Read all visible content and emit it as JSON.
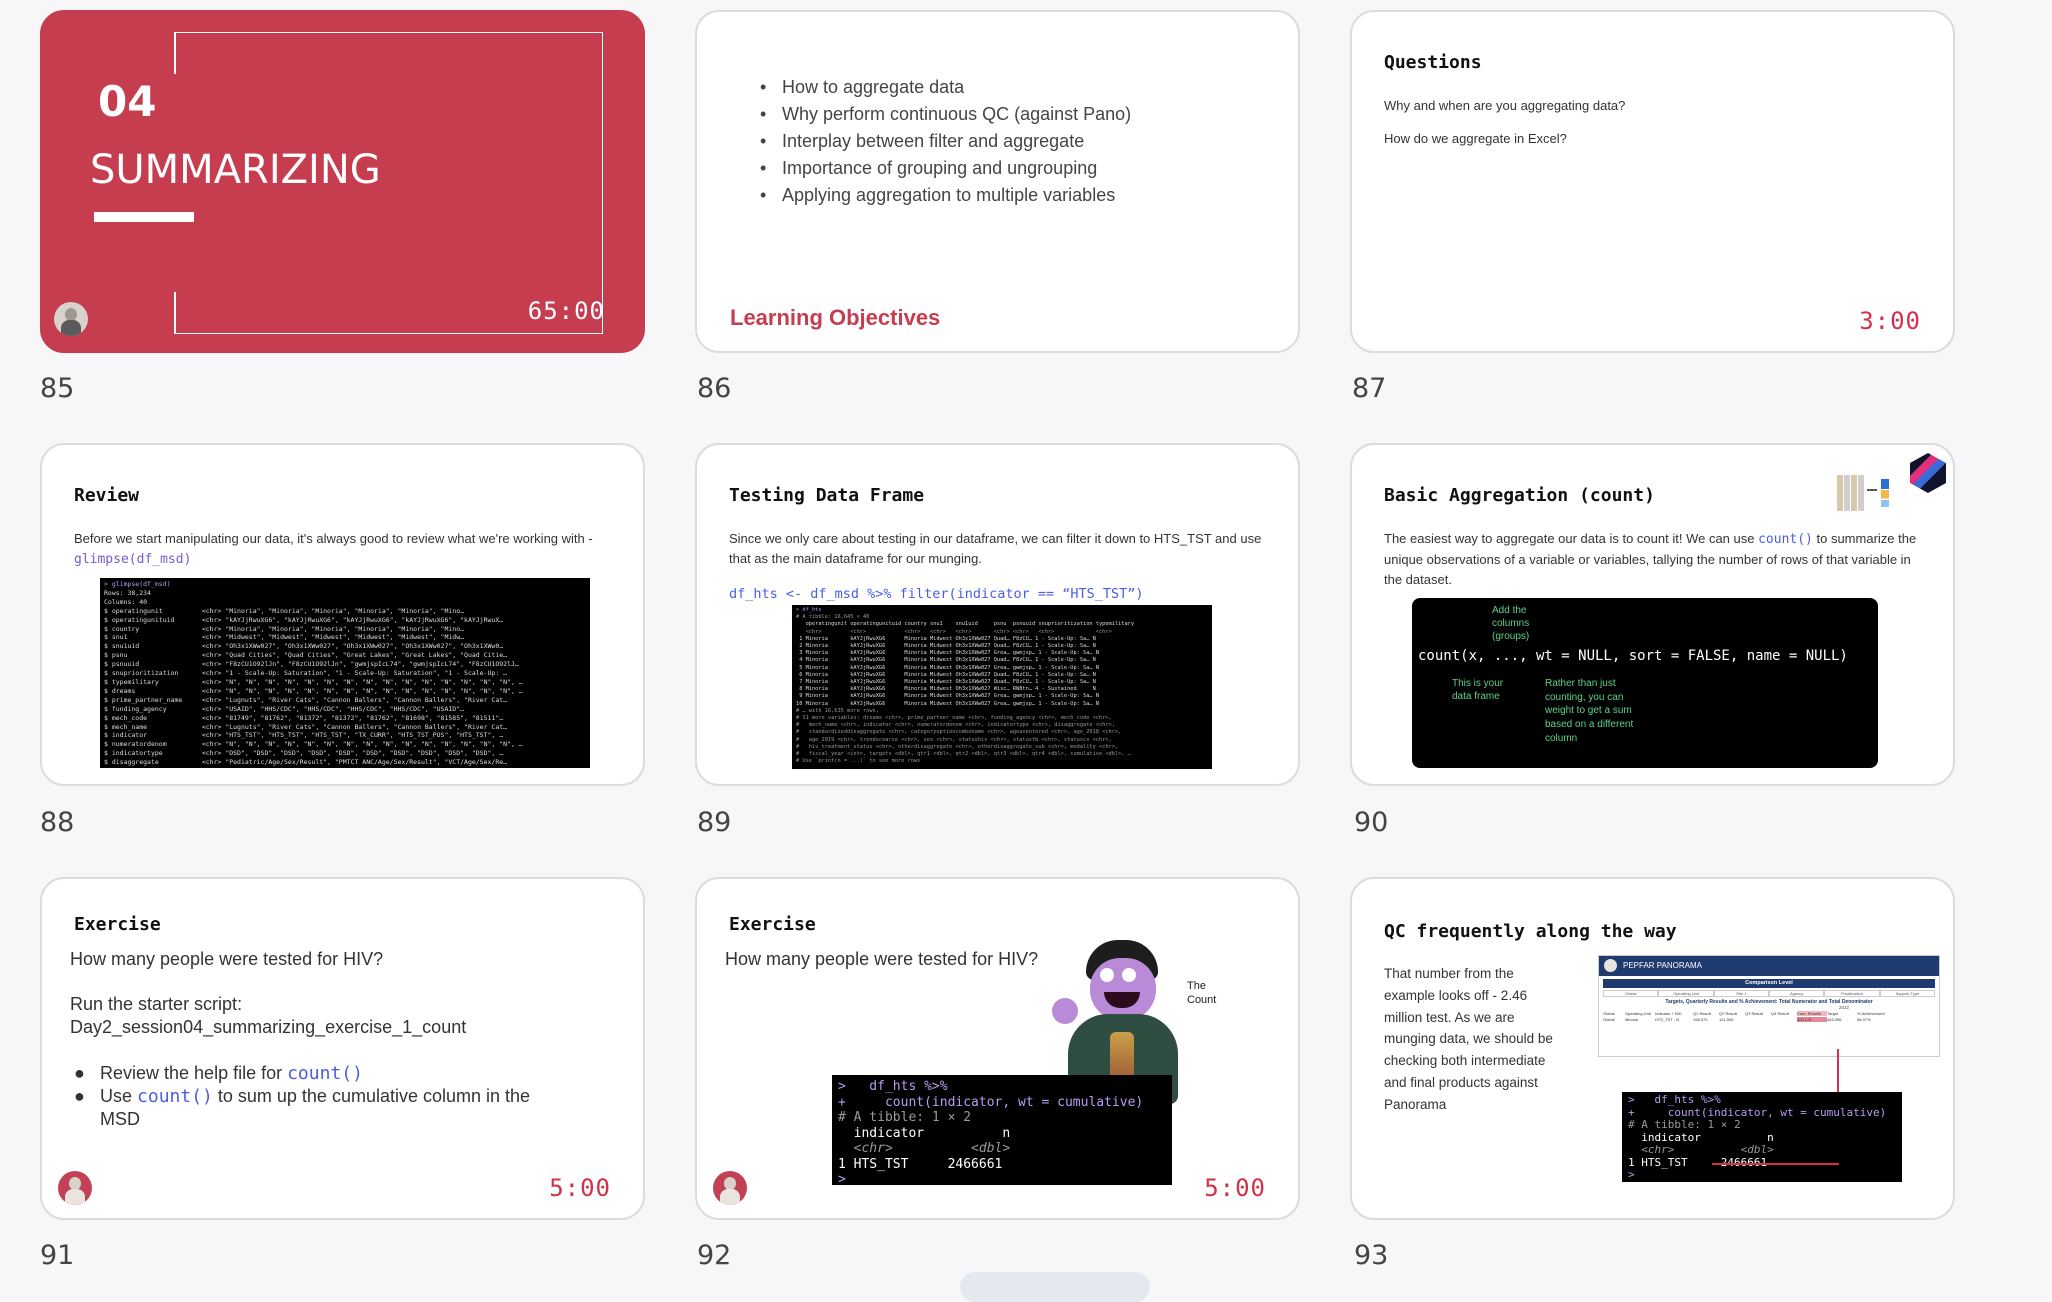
{
  "slides": [
    {
      "number": "85",
      "section_no": "04",
      "section_title": "SUMMARIZING",
      "timer": "65:00"
    },
    {
      "number": "86",
      "objectives": [
        "How to aggregate data",
        "Why perform continuous QC (against Pano)",
        "Interplay between filter and aggregate",
        "Importance of grouping and ungrouping",
        "Applying aggregation to multiple variables"
      ],
      "footer_title": "Learning Objectives"
    },
    {
      "number": "87",
      "title": "Questions",
      "q1": "Why and when are you aggregating data?",
      "q2": "How do we aggregate in Excel?",
      "timer": "3:00"
    },
    {
      "number": "88",
      "title": "Review",
      "text_before": "Before we start manipulating our data, it's always good to review what we're working with - ",
      "code": "glimpse(df_msd)",
      "console": [
        "> glimpse(df_msd)",
        "Rows: 38,234",
        "Columns: 40",
        "$ operatingunit          <chr> \"Minoria\", \"Minoria\", \"Minoria\", \"Minoria\", \"Minoria\", \"Mino…",
        "$ operatingunituid       <chr> \"kAYJjRwuXG6\", \"kAYJjRwuXG6\", \"kAYJjRwuXG6\", \"kAYJjRwuXG6\", \"kAYJjRwuX…",
        "$ country                <chr> \"Minoria\", \"Minoria\", \"Minoria\", \"Minoria\", \"Minoria\", \"Mino…",
        "$ snu1                   <chr> \"Midwest\", \"Midwest\", \"Midwest\", \"Midwest\", \"Midwest\", \"Midw…",
        "$ snu1uid                <chr> \"Oh3x1XWw027\", \"Oh3x1XWw027\", \"Oh3x1XWw027\", \"Oh3x1XWw027\", \"Oh3x1XWw0…",
        "$ psnu                   <chr> \"Quad Cities\", \"Quad Cities\", \"Great Lakes\", \"Great Lakes\", \"Quad Citie…",
        "$ psnuuid                <chr> \"F8zCU1O92lJn\", \"F8zCU1O92lJn\", \"gwmjspIcL74\", \"gwmjspIcL74\", \"F8zCU1O92lJ…",
        "$ snuprioritization      <chr> \"1 - Scale-Up: Saturation\", \"1 - Scale-Up: Saturation\", \"1 - Scale-Up: …",
        "$ typemilitary           <chr> \"N\", \"N\", \"N\", \"N\", \"N\", \"N\", \"N\", \"N\", \"N\", \"N\", \"N\", \"N\", \"N\", \"N\", \"N\", …",
        "$ dreams                 <chr> \"N\", \"N\", \"N\", \"N\", \"N\", \"N\", \"N\", \"N\", \"N\", \"N\", \"N\", \"N\", \"N\", \"N\", \"N\", …",
        "$ prime_partner_name     <chr> \"Lugnuts\", \"River Cats\", \"Cannon Ballers\", \"Cannon Ballers\", \"River Cat…",
        "$ funding_agency         <chr> \"USAID\", \"HHS/CDC\", \"HHS/CDC\", \"HHS/CDC\", \"HHS/CDC\", \"USAID\"…",
        "$ mech_code              <chr> \"81749\", \"81762\", \"81372\", \"81372\", \"81762\", \"81698\", \"81585\", \"81511\"…",
        "$ mech_name              <chr> \"Lugnuts\", \"River Cats\", \"Cannon Ballers\", \"Cannon Ballers\", \"River Cat…",
        "$ indicator              <chr> \"HTS_TST\", \"HTS_TST\", \"HTS_TST\", \"TX_CURR\", \"HTS_TST_POS\", \"HTS_TST\", …",
        "$ numeratordenom         <chr> \"N\", \"N\", \"N\", \"N\", \"N\", \"N\", \"N\", \"N\", \"N\", \"N\", \"N\", \"N\", \"N\", \"N\", \"N\", …",
        "$ indicatortype          <chr> \"DSD\", \"DSD\", \"DSD\", \"DSD\", \"DSD\", \"DSD\", \"DSD\", \"DSD\", \"DSD\", \"DSD\", …",
        "$ disaggregate           <chr> \"Pediatric/Age/Sex/Result\", \"PMTCT ANC/Age/Sex/Result\", \"VCT/Age/Sex/Re…",
        "$ standardizeddisaggregate <chr> \"Modality/Age/Sex/Result\", \"Modality/Age/Sex/Result\", \"Modality/Age/Sex…"
      ]
    },
    {
      "number": "89",
      "title": "Testing Data Frame",
      "text": "Since we only care about testing in our dataframe, we can filter it down to HTS_TST and use that as the main dataframe for our munging.",
      "code": "df_hts <- df_msd %>% filter(indicator == “HTS_TST”)",
      "console": [
        "> df_hts",
        "# A tibble: 16,645 × 40",
        "   operatingunit operatingunituid country snu1    snu1uid     psnu  psnuuid snuprioritization typemilitary",
        "   <chr>         <chr>            <chr>   <chr>   <chr>       <chr> <chr>   <chr>             <chr>",
        " 1 Minoria       kAYJjRwuXG6      Minoria Midwest Oh3x1XWw027 Quad… F8zCU… 1 - Scale-Up: Sa… N",
        " 2 Minoria       kAYJjRwuXG6      Minoria Midwest Oh3x1XWw027 Quad… F8zCU… 1 - Scale-Up: Sa… N",
        " 3 Minoria       kAYJjRwuXG6      Minoria Midwest Oh3x1XWw027 Grea… gwmjsp… 1 - Scale-Up: Sa… N",
        " 4 Minoria       kAYJjRwuXG6      Minoria Midwest Oh3x1XWw027 Quad… F8zCU… 1 - Scale-Up: Sa… N",
        " 5 Minoria       kAYJjRwuXG6      Minoria Midwest Oh3x1XWw027 Grea… gwmjsp… 1 - Scale-Up: Sa… N",
        " 6 Minoria       kAYJjRwuXG6      Minoria Midwest Oh3x1XWw027 Quad… F8zCU… 1 - Scale-Up: Sa… N",
        " 7 Minoria       kAYJjRwuXG6      Minoria Midwest Oh3x1XWw027 Quad… F8zCU… 1 - Scale-Up: Sa… N",
        " 8 Minoria       kAYJjRwuXG6      Minoria Midwest Oh3x1XWw027 Wisc… RW8tn… 4 - Sustained     N",
        " 9 Minoria       kAYJjRwuXG6      Minoria Midwest Oh3x1XWw027 Grea… gwmjsp… 1 - Scale-Up: Sa… N",
        "10 Minoria       kAYJjRwuXG6      Minoria Midwest Oh3x1XWw027 Grea… gwmjsp… 1 - Scale-Up: Sa… N",
        "# … with 16,635 more rows,",
        "# 31 more variables: dreams <chr>, prime_partner_name <chr>, funding_agency <chr>, mech_code <chr>,",
        "#   mech_name <chr>, indicator <chr>, numeratordenom <chr>, indicatortype <chr>, disaggregate <chr>,",
        "#   standardizeddisaggregate <chr>, categoryoptioncomboname <chr>, ageasentered <chr>, age_2018 <chr>,",
        "#   age_2019 <chr>, trendscoarse <chr>, sex <chr>, statushiv <chr>, statustb <chr>, statuscx <chr>,",
        "#   hiv_treatment_status <chr>, otherdisaggregate <chr>, otherdisaggregate_sub <chr>, modality <chr>,",
        "#   fiscal_year <int>, targets <dbl>, qtr1 <dbl>, qtr2 <dbl>, qtr3 <dbl>, qtr4 <dbl>, cumulative <dbl>, …",
        "# Use `print(n = ...)` to see more rows"
      ]
    },
    {
      "number": "90",
      "title": "Basic Aggregation (count)",
      "text_before": "The easiest way to aggregate our data is to count it! We can use ",
      "code": "count()",
      "text_after": " to summarize the unique observations of a variable or variables, tallying the number of rows of that variable in the dataset.",
      "signature": "count(x, ..., wt = NULL, sort = FALSE, name = NULL)",
      "note_cols": "Add the columns (groups)",
      "note_data": "This is your data frame",
      "note_wt": "Rather than just counting, you can weight to get a sum based on a different column"
    },
    {
      "number": "91",
      "title": "Exercise",
      "question": "How many people were tested for HIV?",
      "script_label": "Run the starter script:",
      "script_name": "Day2_session04_summarizing_exercise_1_count",
      "b1_text": "Review the help file for ",
      "b1_code": "count()",
      "b2_pre": "Use ",
      "b2_code": "count()",
      "b2_text": " to sum up the cumulative column in the MSD",
      "timer": "5:00"
    },
    {
      "number": "92",
      "title": "Exercise",
      "question": "How many people were tested for HIV?",
      "char_label": "The Count",
      "console": {
        "l1": ">   df_hts %>%",
        "l2": "+     count(indicator, wt = cumulative)",
        "l3": "# A tibble: 1 × 2",
        "l4": "  indicator          n",
        "l5": "  <chr>          <dbl>",
        "l6": "1 HTS_TST     2466661",
        "l7": ">"
      },
      "timer": "5:00"
    },
    {
      "number": "93",
      "title": "QC frequently along the way",
      "text": "That number from the example looks off -  2.46 million test. As we are munging data, we should be checking both intermediate and final products against Panorama",
      "pano_brand": "PEPFAR PANORAMA",
      "pano_heading": "Comparison Level",
      "pano_tabs": [
        "Global",
        "Operating Unit",
        "Site 1",
        "Agency",
        "Prioritization",
        "Support Type"
      ],
      "pano_subtitle": "Targets, Quarterly Results and % Achievement: Total Numerator and Total Denominator",
      "pano_year": "2022",
      "pano_headers": [
        "Global",
        "Operating Unit",
        "Indicator + N/D",
        "Q1 Result",
        "Q2 Result",
        "Q3 Result",
        "Q4 Result",
        "Cum. Results",
        "Target",
        "% Achievement"
      ],
      "pano_row": [
        "Global",
        "Minoria",
        "HTS_TST - N",
        "198,370",
        "121,505",
        "",
        "",
        "320,175",
        "463,396",
        "56.97%"
      ],
      "console": {
        "l1": ">   df_hts %>%",
        "l2": "+     count(indicator, wt = cumulative)",
        "l3": "# A tibble: 1 × 2",
        "l4": "  indicator          n",
        "l5": "  <chr>          <dbl>",
        "l6": "1 HTS_TST     2466661",
        "l7": ">"
      }
    }
  ],
  "colors": {
    "accent": "#c53d4f",
    "timer": "#d0324a",
    "code_purple": "#7a5bc9",
    "code_blue": "#4b5ee0",
    "terminal_bg": "#000000",
    "green_note": "#5fd18a"
  }
}
